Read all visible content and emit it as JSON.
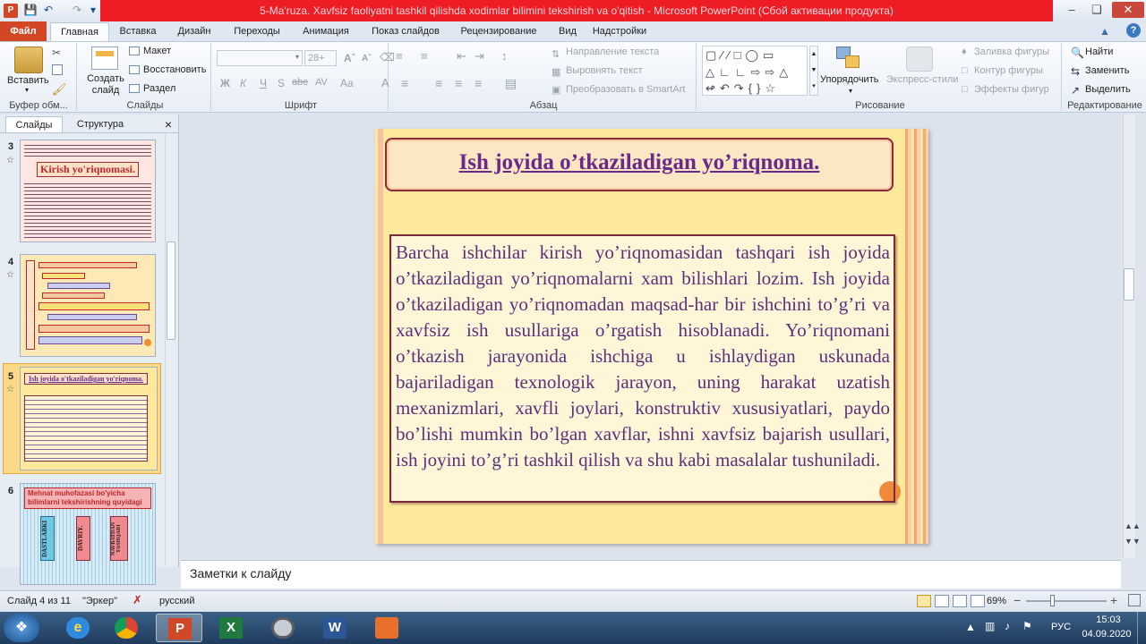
{
  "window": {
    "title": "5-Ma'ruza. Xavfsiz faoliyatni tashkil qilishda xodimlar bilimini tekshirish va o'qitish - Microsoft PowerPoint (Сбой активации продукта)"
  },
  "ribbon": {
    "tabs": [
      "Файл",
      "Главная",
      "Вставка",
      "Дизайн",
      "Переходы",
      "Анимация",
      "Показ слайдов",
      "Рецензирование",
      "Вид",
      "Надстройки"
    ],
    "clipboard": {
      "paste": "Вставить",
      "label": "Буфер обм..."
    },
    "slides": {
      "new_slide_1": "Создать",
      "new_slide_2": "слайд",
      "layout": "Макет",
      "reset": "Восстановить",
      "section": "Раздел",
      "label": "Слайды"
    },
    "font": {
      "size": "28+",
      "bold": "Ж",
      "italic": "К",
      "underline": "Ч",
      "strike": "S",
      "shadow": "abe",
      "spacing": "AV",
      "case": "Aa",
      "label": "Шрифт"
    },
    "paragraph": {
      "text_direction": "Направление текста",
      "align_text": "Выровнять текст",
      "smartart": "Преобразовать в SmartArt",
      "label": "Абзац"
    },
    "drawing": {
      "arrange": "Упорядочить",
      "quick_styles": "Экспресс-стили",
      "fill": "Заливка фигуры",
      "outline": "Контур фигуры",
      "effects": "Эффекты фигур",
      "label": "Рисование"
    },
    "editing": {
      "find": "Найти",
      "replace": "Заменить",
      "select": "Выделить",
      "label": "Редактирование"
    }
  },
  "left_pane": {
    "tabs": [
      "Слайды",
      "Структура"
    ],
    "close": "×",
    "thumbs": [
      {
        "num": "3",
        "title": "Kirish yo'riqnomasi."
      },
      {
        "num": "4",
        "title": ""
      },
      {
        "num": "5",
        "title": "Ish joyida o'tkaziladigan yo'riqnoma."
      },
      {
        "num": "6",
        "title": "Mehnat muhofazasi bo'yicha bilimlarni tekshirishning quyidagi turlari belgilangan",
        "cols": [
          "DASTLABKI",
          "DAVRIY.",
          "NAVBATDAN TASHQARI"
        ]
      }
    ]
  },
  "slide": {
    "title": "Ish joyida o’tkaziladigan yo’riqnoma.",
    "body": "Barcha ishchilar kirish yo’riqnomasidan tashqari ish joyida o’tkaziladigan yo’riqnomalarni xam bilishlari lozim. Ish joyida o’tkaziladigan yo’riqnomadan maqsad-har bir ishchini to’g’ri va xavfsiz ish usullariga o’rgatish hisoblanadi. Yo’riqnomani o’tkazish jarayonida ishchiga u ishlaydigan uskunada bajariladigan texnologik jarayon, uning harakat uzatish mexanizmlari, xavfli joylari, konstruktiv xususiyatlari, paydo bo’lishi mumkin bo’lgan xavflar, ishni xavfsiz bajarish usullari, ish joyini to’g’ri tashkil qilish va shu kabi masalalar tushuniladi."
  },
  "notes": {
    "placeholder": "Заметки к слайду"
  },
  "status": {
    "slide_info": "Слайд 4 из 11",
    "theme": "\"Эркер\"",
    "language": "русский",
    "zoom": "69%"
  },
  "taskbar": {
    "lang": "РУС",
    "time": "15:03",
    "date": "04.09.2020"
  },
  "colors": {
    "title_red": "#ee1c24",
    "slide_bg": "#fde89b",
    "title_text": "#6b2a8a",
    "body_text": "#5b2f7a",
    "frame": "#8a2a3a"
  }
}
